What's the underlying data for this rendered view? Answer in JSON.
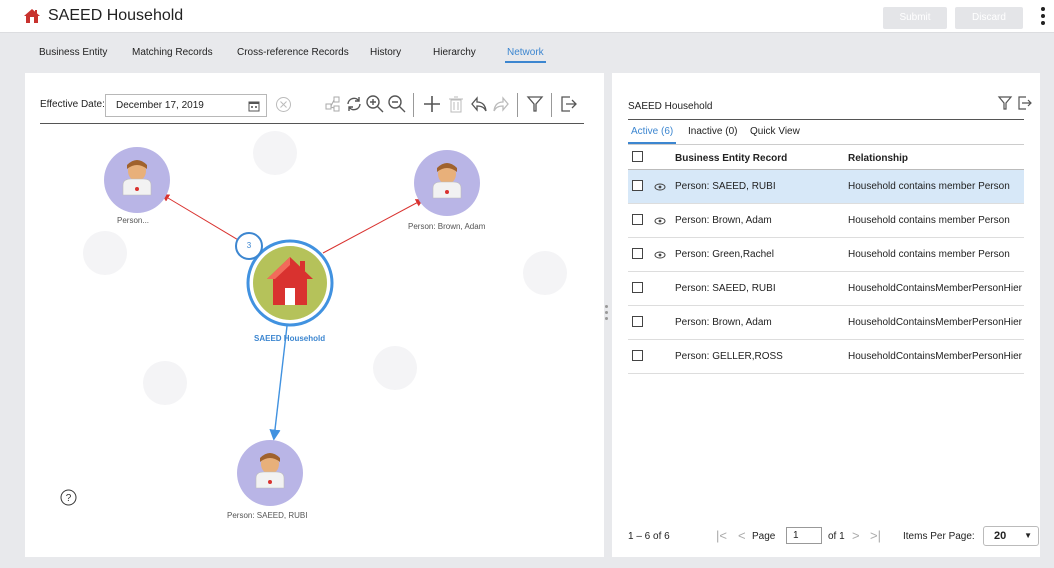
{
  "header": {
    "title": "SAEED Household",
    "submit_label": "Submit",
    "discard_label": "Discard"
  },
  "tabs": [
    "Business Entity",
    "Matching Records",
    "Cross-reference Records",
    "History",
    "Hierarchy",
    "Network"
  ],
  "active_tab": "Network",
  "graph": {
    "effective_date_label": "Effective Date:",
    "effective_date": "December 17, 2019",
    "main_node_label": "SAEED Household",
    "badge_count": "3",
    "nodes": [
      "Person...",
      "Person: Brown, Adam",
      "Person: SAEED, RUBI"
    ],
    "colors": {
      "node_bg": "#b9b5e6",
      "main_node_bg": "#b5c25a",
      "red_edge": "#d9322f",
      "blue_edge": "#4192e0"
    }
  },
  "right_panel": {
    "title": "SAEED Household",
    "subtabs": [
      "Active (6)",
      "Inactive (0)",
      "Quick View"
    ],
    "columns": [
      "Business Entity Record",
      "Relationship"
    ],
    "rows": [
      {
        "record": "Person: SAEED, RUBI",
        "relationship": "Household contains member Person"
      },
      {
        "record": "Person: Brown, Adam",
        "relationship": "Household contains member Person"
      },
      {
        "record": "Person: Green,Rachel",
        "relationship": "Household contains member Person"
      },
      {
        "record": "Person: SAEED, RUBI",
        "relationship": "HouseholdContainsMemberPersonHier"
      },
      {
        "record": "Person: Brown, Adam",
        "relationship": "HouseholdContainsMemberPersonHier"
      },
      {
        "record": "Person: GELLER,ROSS",
        "relationship": "HouseholdContainsMemberPersonHier"
      }
    ],
    "pager": {
      "range": "1 – 6 of 6",
      "page_label": "Page",
      "page": "1",
      "of_label": "of 1",
      "items_per_page_label": "Items Per Page:",
      "items_per_page": "20"
    }
  },
  "accent_color": "#3c86d0"
}
